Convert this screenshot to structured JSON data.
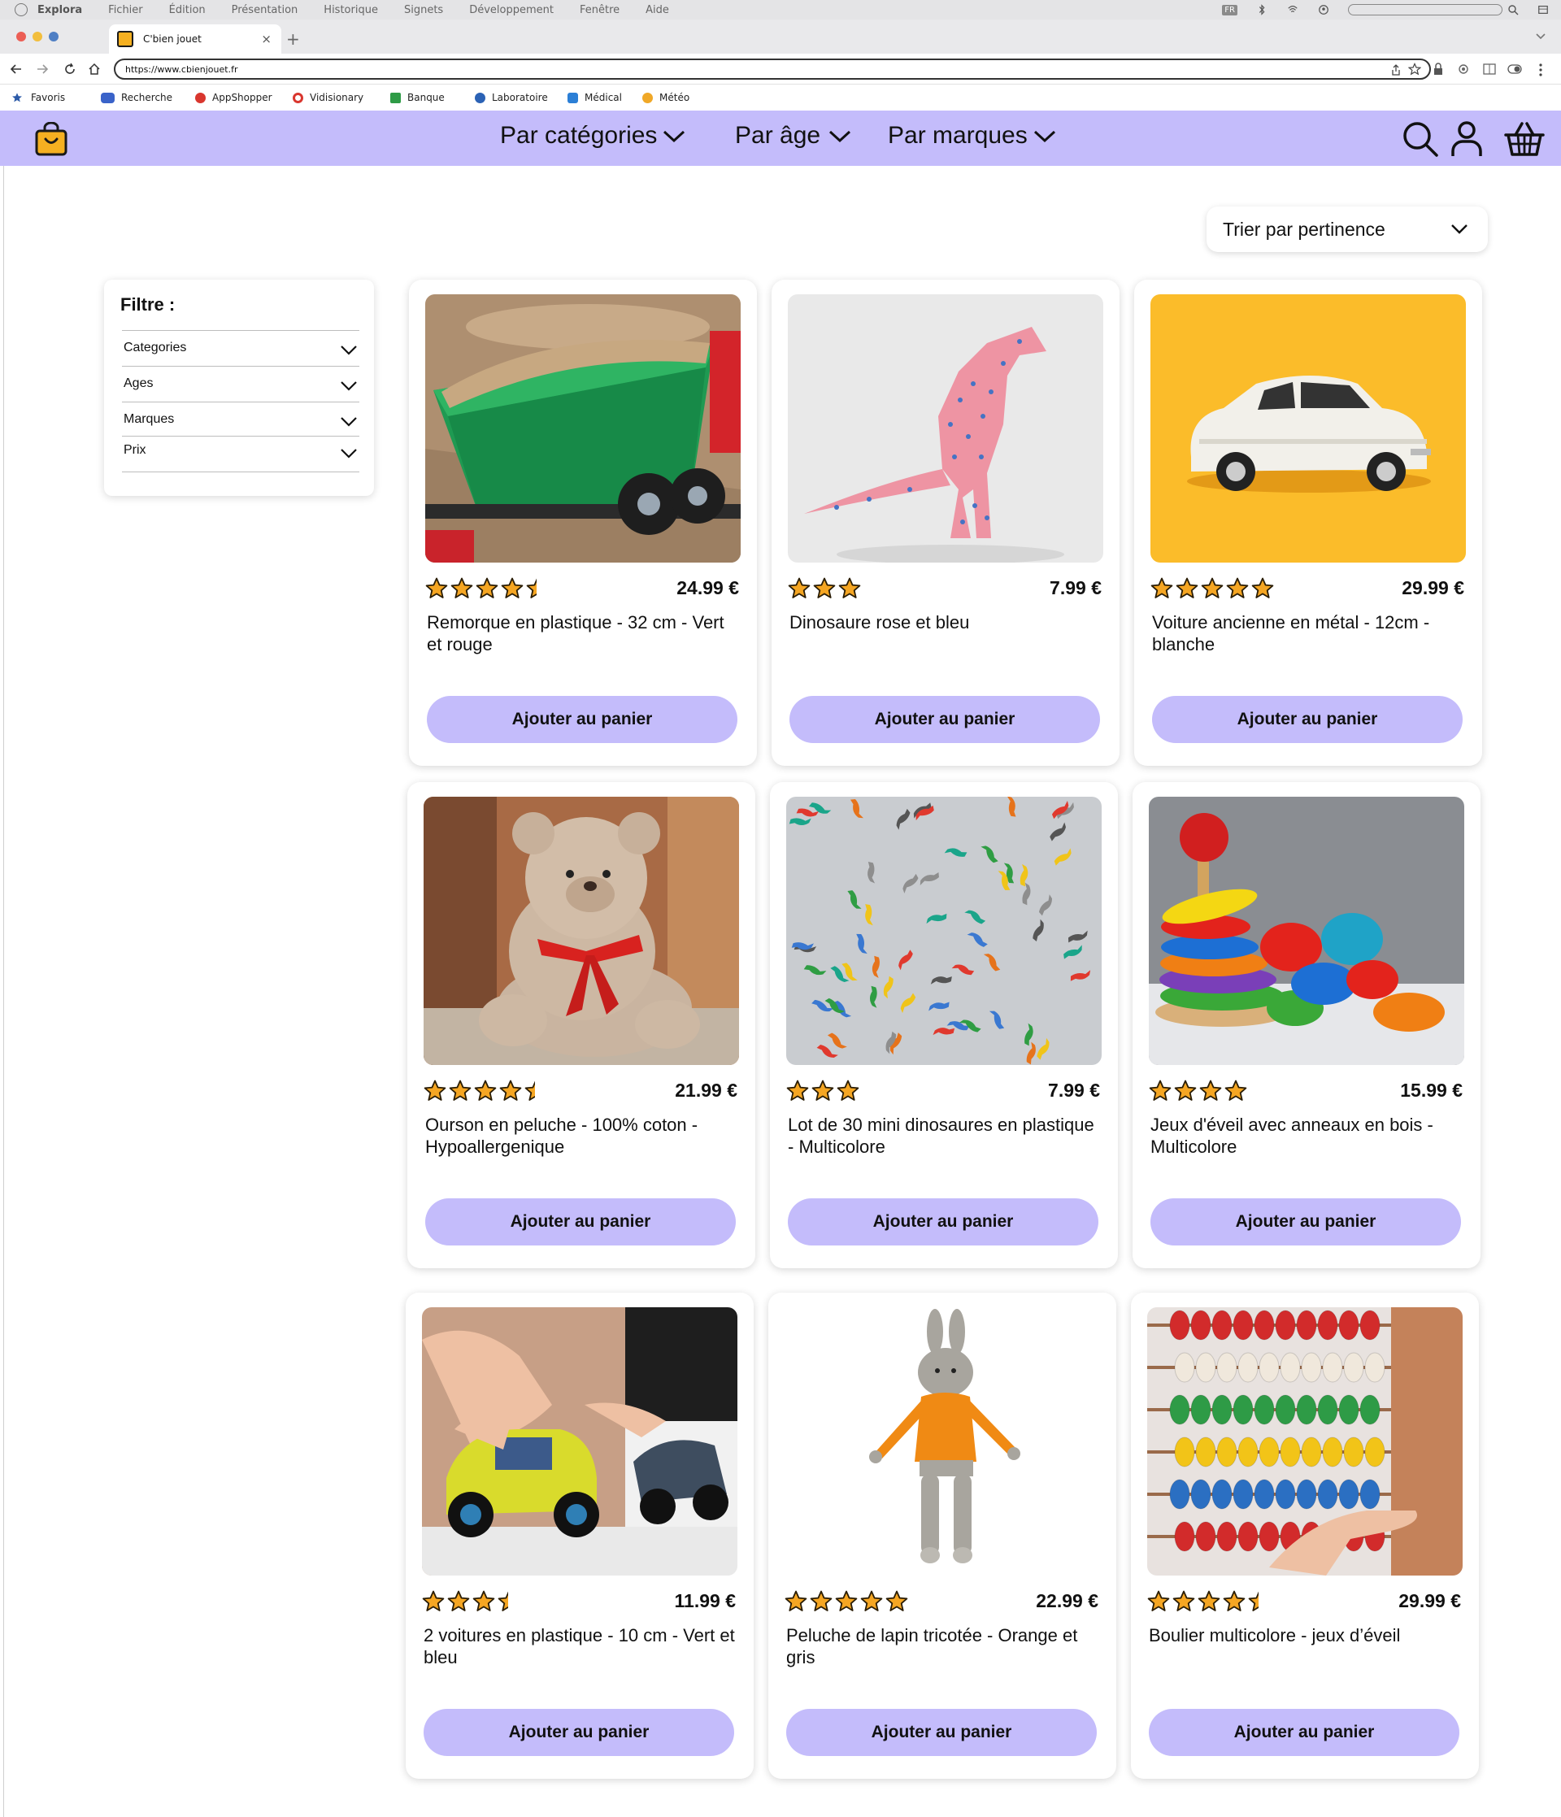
{
  "menubar": {
    "items": [
      "Explora",
      "Fichier",
      "Édition",
      "Présentation",
      "Historique",
      "Signets",
      "Développement",
      "Fenêtre",
      "Aide"
    ],
    "language_badge": "FR"
  },
  "tab": {
    "title": "C'bien jouet",
    "close": "×",
    "new_tab": "+"
  },
  "addressbar": {
    "url": "https://www.cbienjouet.fr"
  },
  "bookmarks": [
    "Favoris",
    "Recherche",
    "AppShopper",
    "Vidisionary",
    "Banque",
    "Laboratoire",
    "Médical",
    "Météo"
  ],
  "colors": {
    "brand_lavender": "#c4bcfb",
    "star": "#f5a623",
    "logo_yellow": "#f5b021"
  },
  "nav": {
    "categories": "Par catégories",
    "age": "Par âge",
    "brands": "Par marques"
  },
  "sort": {
    "label": "Trier par pertinence"
  },
  "filter": {
    "title": "Filtre :",
    "rows": [
      "Categories",
      "Ages",
      "Marques",
      "Prix"
    ]
  },
  "products": [
    {
      "name": "Remorque en plastique - 32 cm  - Vert et rouge",
      "price": "24.99 €",
      "rating": 4.5,
      "button": "Ajouter au panier",
      "image": "toy-trailer-in-sand"
    },
    {
      "name": "Dinosaure rose et bleu",
      "price": "7.99 €",
      "rating": 3,
      "button": "Ajouter au panier",
      "image": "pink-dinosaur-figure"
    },
    {
      "name": "Voiture ancienne en métal - 12cm - blanche",
      "price": "29.99 €",
      "rating": 5,
      "button": "Ajouter au panier",
      "image": "white-vintage-car"
    },
    {
      "name": "Ourson en peluche - 100% coton - Hypoallergenique",
      "price": "21.99 €",
      "rating": 4.5,
      "button": "Ajouter au panier",
      "image": "teddy-bear"
    },
    {
      "name": "Lot de 30 mini dinosaures en plastique - Multicolore",
      "price": "7.99 €",
      "rating": 3,
      "button": "Ajouter au panier",
      "image": "mini-dinosaurs"
    },
    {
      "name": "Jeux d'éveil avec anneaux en bois - Multicolore",
      "price": "15.99 €",
      "rating": 4,
      "button": "Ajouter au panier",
      "image": "wooden-ring-stacker"
    },
    {
      "name": "2 voitures en plastique - 10 cm - Vert et bleu",
      "price": "11.99 €",
      "rating": 3.5,
      "button": "Ajouter au panier",
      "image": "two-plastic-cars"
    },
    {
      "name": "Peluche de lapin tricotée - Orange et gris",
      "price": "22.99 €",
      "rating": 5,
      "button": "Ajouter au panier",
      "image": "knitted-rabbit"
    },
    {
      "name": "Boulier multicolore - jeux d’éveil",
      "price": "29.99 €",
      "rating": 4.5,
      "button": "Ajouter au panier",
      "image": "abacus"
    }
  ]
}
